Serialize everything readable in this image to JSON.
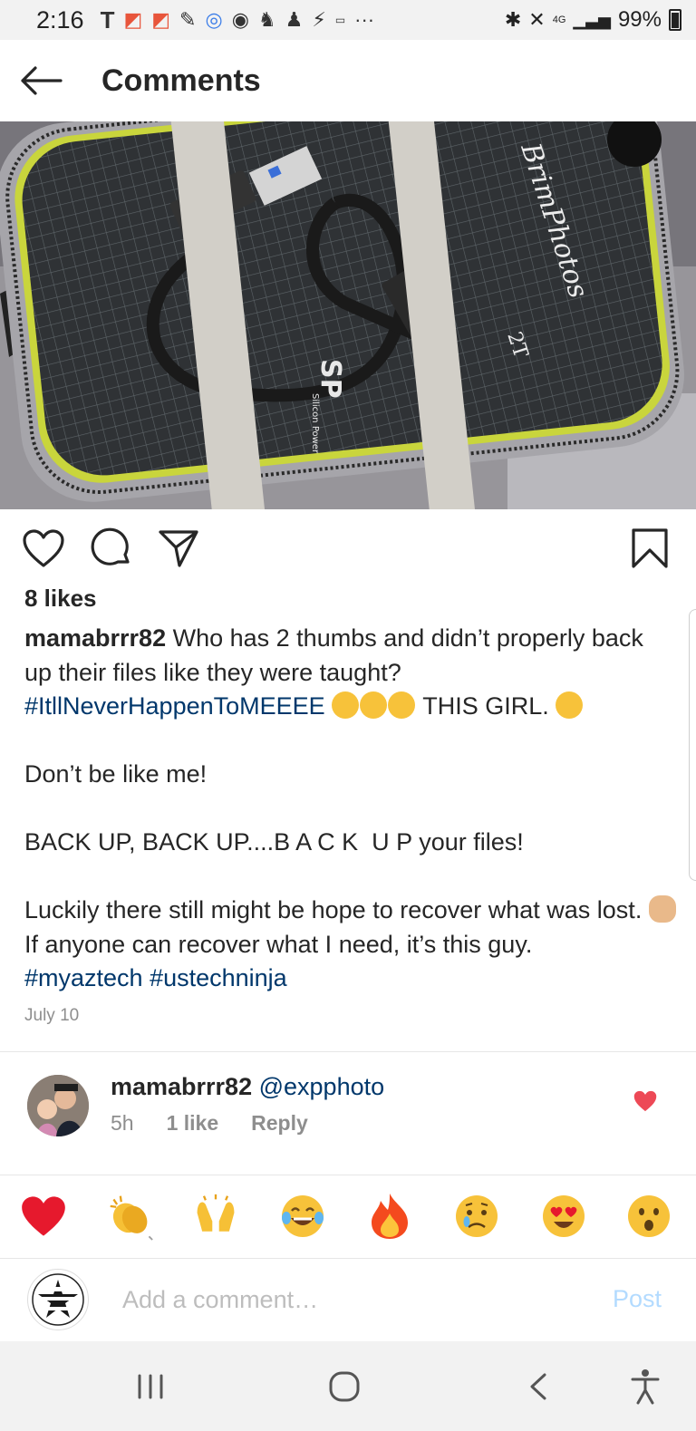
{
  "status_bar": {
    "time": "2:16",
    "signal": "4G",
    "battery": "99%",
    "left_icons": [
      "t-mobile-icon",
      "app-icon",
      "app-icon",
      "pen-icon",
      "chat-icon",
      "target-icon",
      "app-icon",
      "person-icon",
      "bolt-icon",
      "amazon-icon",
      "more-icon"
    ]
  },
  "header": {
    "title": "Comments"
  },
  "post": {
    "likes": "8 likes",
    "username": "mamabrrr82",
    "caption": {
      "line1": "Who has 2 thumbs and didn’t properly back up their files like they were taught?",
      "hashtag1": "#ItllNeverHappenToMEEEE",
      "after_hashtag1": "THIS GIRL.",
      "line2": "Don’t be like me!",
      "line3": "BACK UP, BACK UP....B A C K  U P your files!",
      "line4a": "Luckily there still might be hope to recover what was lost.",
      "line4b": "If anyone can recover what I need, it’s this guy.",
      "hashtag2": "#myaztech",
      "hashtag3": "#ustechninja"
    },
    "date": "July 10",
    "photo_text": {
      "brand": "SP",
      "brand_sub": "Silicon Power",
      "label": "BrimPhotos",
      "label_sub": "2T"
    }
  },
  "comment": {
    "username": "mamabrrr82",
    "mention": "@expphoto",
    "time": "5h",
    "likes": "1 like",
    "reply_label": "Reply"
  },
  "reactions": [
    "heart",
    "clap",
    "raised-hands",
    "joy",
    "fire",
    "cry",
    "heart-eyes",
    "wow"
  ],
  "composer": {
    "placeholder": "Add a comment…",
    "post_label": "Post"
  },
  "colors": {
    "link": "#00376b",
    "muted": "#8e8e8e",
    "like_red": "#ed4956",
    "post_disabled": "#b3dbff"
  }
}
